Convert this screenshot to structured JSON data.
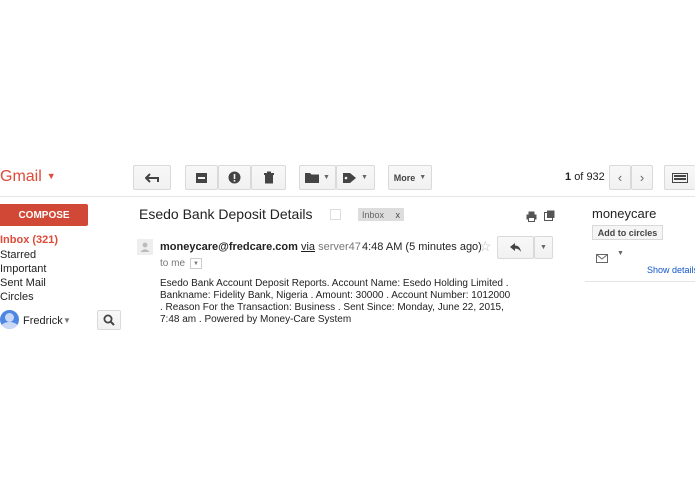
{
  "app": {
    "logo": "Gmail"
  },
  "toolbar": {
    "more_label": "More",
    "pager": {
      "current": "1",
      "of_label": "of",
      "total": "932"
    }
  },
  "sidebar": {
    "compose_label": "COMPOSE",
    "items": [
      {
        "label": "Inbox (321)",
        "active": true
      },
      {
        "label": "Starred"
      },
      {
        "label": "Important"
      },
      {
        "label": "Sent Mail"
      },
      {
        "label": "Circles"
      }
    ],
    "user_name": "Fredrick"
  },
  "message": {
    "subject": "Esedo Bank Deposit Details",
    "label": "Inbox",
    "label_remove": "x",
    "from": "moneycare@fredcare.com",
    "via_label": "via",
    "via_server": "server47",
    "time": "4:48 AM (5 minutes ago)",
    "to": "to me",
    "body_lines": [
      "Esedo Bank Account Deposit Reports.   Account Name:  Esedo Holding Limited .",
      "  Bankname:  Fidelity Bank, Nigeria .   Amount:  30000 .   Account Number:  1012000",
      ".   Reason For the Transaction:  Business .   Sent Since: Monday, June 22, 2015,",
      "7:48 am  .   Powered by Money-Care System"
    ]
  },
  "contact": {
    "name": "moneycare",
    "add_label": "Add to circles",
    "show_details": "Show details"
  },
  "colors": {
    "accent": "#dd4b39",
    "compose": "#d14836",
    "link": "#1155cc"
  }
}
